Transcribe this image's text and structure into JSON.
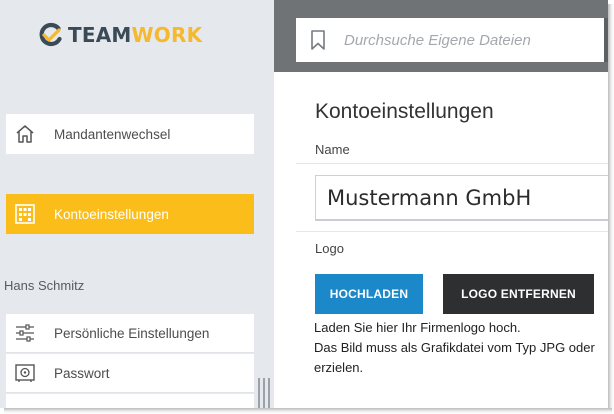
{
  "colors": {
    "accent": "#fbbd1a",
    "primary_button": "#1a88c9",
    "dark_button": "#2d2f31",
    "sidebar_bg": "#e5e9ee",
    "topbar_bg": "#6f7375"
  },
  "brand": {
    "part1": "TEAM",
    "part2": "WORK"
  },
  "sidebar": {
    "items": [
      {
        "label": "Mandantenwechsel",
        "icon": "home-icon"
      },
      {
        "label": "Kontoeinstellungen",
        "icon": "building-icon",
        "active": true
      }
    ],
    "section_title": "Hans Schmitz",
    "user_items": [
      {
        "label": "Persönliche Einstellungen",
        "icon": "sliders-icon"
      },
      {
        "label": "Passwort",
        "icon": "safe-icon"
      }
    ]
  },
  "search": {
    "placeholder": "Durchsuche Eigene Dateien",
    "icon": "bookmark-icon"
  },
  "main": {
    "title": "Kontoeinstellungen",
    "name_label": "Name",
    "name_value": "Mustermann GmbH",
    "logo_label": "Logo",
    "upload_label": "HOCHLADEN",
    "remove_label": "LOGO ENTFERNEN",
    "help_lines": [
      "Laden Sie hier Ihr Firmenlogo hoch.",
      "Das Bild muss als Grafikdatei vom Typ JPG oder",
      "erzielen."
    ]
  }
}
